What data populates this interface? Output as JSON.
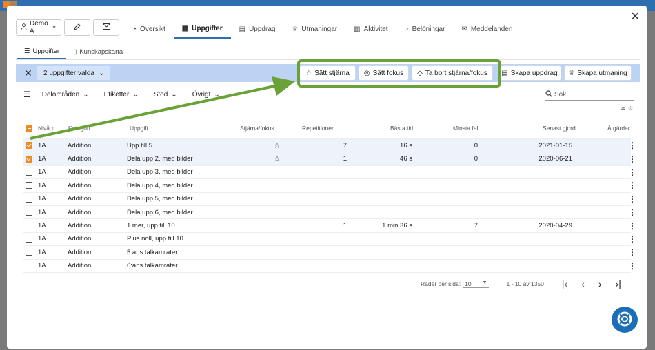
{
  "top_actions": {
    "user_label": "Demo A"
  },
  "nav_tabs": [
    {
      "label": "Översikt"
    },
    {
      "label": "Uppgifter"
    },
    {
      "label": "Uppdrag"
    },
    {
      "label": "Utmaningar"
    },
    {
      "label": "Aktivitet"
    },
    {
      "label": "Belöningar"
    },
    {
      "label": "Meddelanden"
    }
  ],
  "sub_tabs": [
    {
      "label": "Uppgifter"
    },
    {
      "label": "Kunskapskarta"
    }
  ],
  "selection": {
    "count_label": "2 uppgifter valda",
    "buttons": {
      "star": "Sätt stjärna",
      "focus": "Sätt fokus",
      "remove": "Ta bort stjärna/fokus",
      "create_mission": "Skapa uppdrag",
      "create_challenge": "Skapa utmaning"
    }
  },
  "filters": [
    "Delområden",
    "Etiketter",
    "Stöd",
    "Övrigt"
  ],
  "search": {
    "placeholder": "Sök"
  },
  "table": {
    "headers": {
      "level": "Nivå",
      "category": "Kategori",
      "task": "Uppgift",
      "star": "Stjärna/fokus",
      "reps": "Repetitioner",
      "best": "Bästa tid",
      "min_err": "Minsta fel",
      "last": "Senast gjord",
      "actions": "Åtgärder"
    },
    "rows": [
      {
        "level": "1A",
        "category": "Addition",
        "task": "Upp till 5",
        "star": true,
        "reps": "7",
        "best": "16 s",
        "min_err": "0",
        "last": "2021-01-15",
        "selected": true
      },
      {
        "level": "1A",
        "category": "Addition",
        "task": "Dela upp 2, med bilder",
        "star": true,
        "reps": "1",
        "best": "46 s",
        "min_err": "0",
        "last": "2020-06-21",
        "selected": true
      },
      {
        "level": "1A",
        "category": "Addition",
        "task": "Dela upp 3, med bilder",
        "star": false,
        "reps": "",
        "best": "",
        "min_err": "",
        "last": "",
        "selected": false
      },
      {
        "level": "1A",
        "category": "Addition",
        "task": "Dela upp 4, med bilder",
        "star": false,
        "reps": "",
        "best": "",
        "min_err": "",
        "last": "",
        "selected": false
      },
      {
        "level": "1A",
        "category": "Addition",
        "task": "Dela upp 5, med bilder",
        "star": false,
        "reps": "",
        "best": "",
        "min_err": "",
        "last": "",
        "selected": false
      },
      {
        "level": "1A",
        "category": "Addition",
        "task": "Dela upp 6, med bilder",
        "star": false,
        "reps": "",
        "best": "",
        "min_err": "",
        "last": "",
        "selected": false
      },
      {
        "level": "1A",
        "category": "Addition",
        "task": "1 mer, upp till 10",
        "star": false,
        "reps": "1",
        "best": "1 min 36 s",
        "min_err": "7",
        "last": "2020-04-29",
        "selected": false
      },
      {
        "level": "1A",
        "category": "Addition",
        "task": "Plus noll, upp till 10",
        "star": false,
        "reps": "",
        "best": "",
        "min_err": "",
        "last": "",
        "selected": false
      },
      {
        "level": "1A",
        "category": "Addition",
        "task": "5:ans talkamrater",
        "star": false,
        "reps": "",
        "best": "",
        "min_err": "",
        "last": "",
        "selected": false
      },
      {
        "level": "1A",
        "category": "Addition",
        "task": "6:ans talkamrater",
        "star": false,
        "reps": "",
        "best": "",
        "min_err": "",
        "last": "",
        "selected": false
      }
    ]
  },
  "pager": {
    "rows_label": "Rader per sida:",
    "rows_value": "10",
    "range": "1 - 10 av 1350"
  },
  "colors": {
    "accent": "#2f6fb0",
    "checkbox": "#f08a24",
    "highlight": "#6aa237",
    "selbar": "#bcd3f4"
  }
}
